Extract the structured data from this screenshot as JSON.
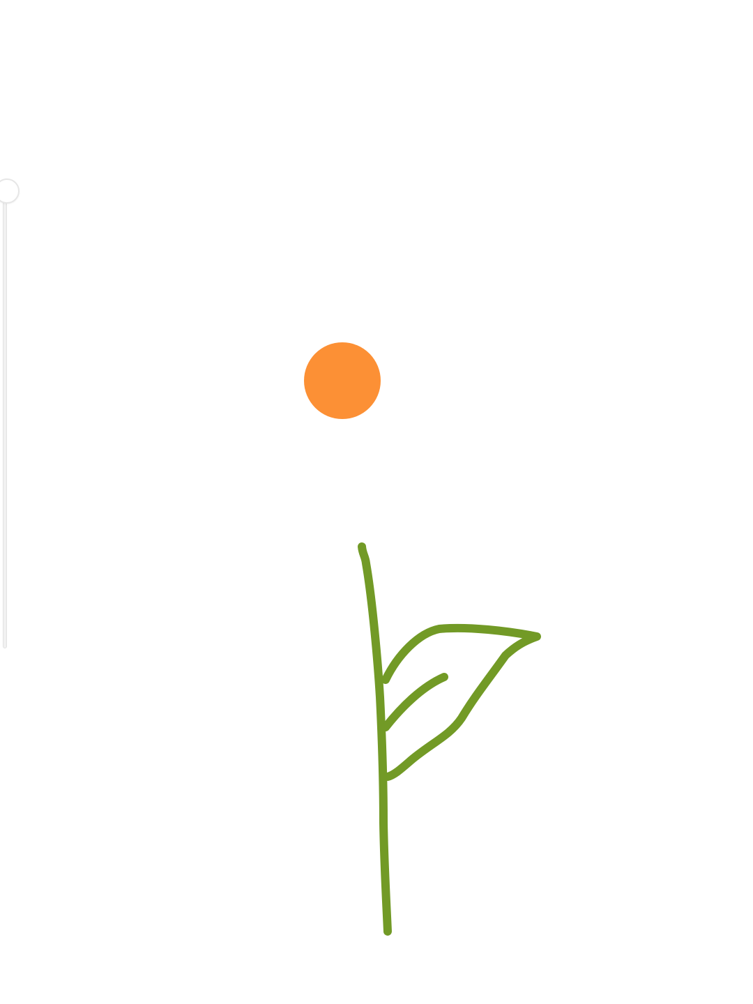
{
  "slider": {
    "level": 1.0
  },
  "drawing": {
    "accent_stroke_color": "#729a26",
    "dot_color": "#fc9035",
    "subjects": [
      "orange-dot",
      "plant-stem",
      "leaf",
      "leaf-vein"
    ]
  }
}
